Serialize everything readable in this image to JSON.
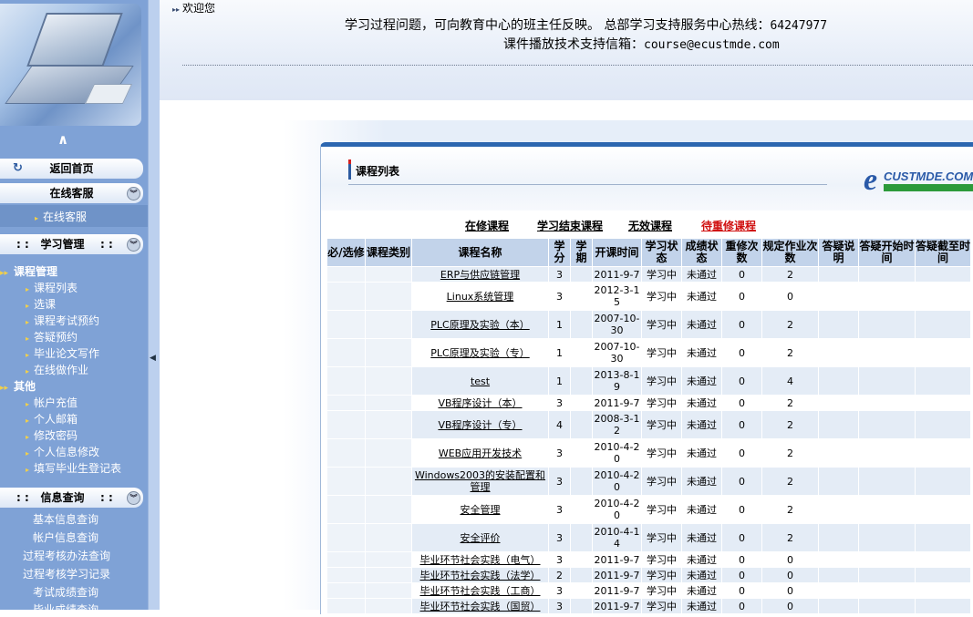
{
  "sidebar": {
    "home_label": "返回首页",
    "online_service": {
      "header": "在线客服",
      "items": [
        "在线客服"
      ]
    },
    "study_mgmt": {
      "header": "学习管理",
      "groups": [
        {
          "label": "课程管理",
          "items": [
            "课程列表",
            "选课",
            "课程考试预约",
            "答疑预约",
            "毕业论文写作",
            "在线做作业"
          ]
        },
        {
          "label": "其他",
          "items": [
            "帐户充值",
            "个人邮箱",
            "修改密码",
            "个人信息修改",
            "填写毕业生登记表"
          ]
        }
      ]
    },
    "info_query": {
      "header": "信息查询",
      "items": [
        "基本信息查询",
        "帐户信息查询",
        "过程考核办法查询",
        "过程考核学习记录",
        "考试成绩查询",
        "毕业成绩查询"
      ]
    }
  },
  "header": {
    "welcome": "欢迎您",
    "notice_line1_text": "学习过程问题，可向教育中心的班主任反映。 总部学习支持服务中心热线：",
    "hotline": "64247977",
    "notice_line2_text": "课件播放技术支持信箱：",
    "email": "course@ecustmde.com"
  },
  "panel": {
    "title": "课程列表",
    "logo_text": "CUSTMDE.COM",
    "logo_letter": "e",
    "tabs": [
      {
        "label": "在修课程",
        "active": false
      },
      {
        "label": "学习结束课程",
        "active": false
      },
      {
        "label": "无效课程",
        "active": false
      },
      {
        "label": "待重修课程",
        "active": true
      }
    ],
    "columns": [
      "必/选修",
      "课程类别",
      "课程名称",
      "学分",
      "学期",
      "开课时间",
      "学习状态",
      "成绩状态",
      "重修次数",
      "规定作业次数",
      "答疑说明",
      "答疑开始时间",
      "答疑截至时间"
    ],
    "rows": [
      {
        "name": "ERP与供应链管理",
        "credit": "3",
        "term": "",
        "start": "2011-9-7",
        "study": "学习中",
        "grade": "未通过",
        "retake": "0",
        "hw": "2"
      },
      {
        "name": "Linux系统管理",
        "credit": "3",
        "term": "",
        "start": "2012-3-15",
        "study": "学习中",
        "grade": "未通过",
        "retake": "0",
        "hw": "0"
      },
      {
        "name": "PLC原理及实验（本）",
        "credit": "1",
        "term": "",
        "start": "2007-10-30",
        "study": "学习中",
        "grade": "未通过",
        "retake": "0",
        "hw": "2"
      },
      {
        "name": "PLC原理及实验（专）",
        "credit": "1",
        "term": "",
        "start": "2007-10-30",
        "study": "学习中",
        "grade": "未通过",
        "retake": "0",
        "hw": "2"
      },
      {
        "name": "test",
        "credit": "1",
        "term": "",
        "start": "2013-8-19",
        "study": "学习中",
        "grade": "未通过",
        "retake": "0",
        "hw": "4"
      },
      {
        "name": "VB程序设计（本）",
        "credit": "3",
        "term": "",
        "start": "2011-9-7",
        "study": "学习中",
        "grade": "未通过",
        "retake": "0",
        "hw": "2"
      },
      {
        "name": "VB程序设计（专）",
        "credit": "4",
        "term": "",
        "start": "2008-3-12",
        "study": "学习中",
        "grade": "未通过",
        "retake": "0",
        "hw": "2"
      },
      {
        "name": "WEB应用开发技术",
        "credit": "3",
        "term": "",
        "start": "2010-4-20",
        "study": "学习中",
        "grade": "未通过",
        "retake": "0",
        "hw": "2"
      },
      {
        "name": "Windows2003的安装配置和管理",
        "credit": "3",
        "term": "",
        "start": "2010-4-20",
        "study": "学习中",
        "grade": "未通过",
        "retake": "0",
        "hw": "2"
      },
      {
        "name": "安全管理",
        "credit": "3",
        "term": "",
        "start": "2010-4-20",
        "study": "学习中",
        "grade": "未通过",
        "retake": "0",
        "hw": "2"
      },
      {
        "name": "安全评价",
        "credit": "3",
        "term": "",
        "start": "2010-4-14",
        "study": "学习中",
        "grade": "未通过",
        "retake": "0",
        "hw": "2"
      },
      {
        "name": "毕业环节社会实践（电气）",
        "credit": "3",
        "term": "",
        "start": "2011-9-7",
        "study": "学习中",
        "grade": "未通过",
        "retake": "0",
        "hw": "0"
      },
      {
        "name": "毕业环节社会实践（法学）",
        "credit": "2",
        "term": "",
        "start": "2011-9-7",
        "study": "学习中",
        "grade": "未通过",
        "retake": "0",
        "hw": "0"
      },
      {
        "name": "毕业环节社会实践（工商）",
        "credit": "3",
        "term": "",
        "start": "2011-9-7",
        "study": "学习中",
        "grade": "未通过",
        "retake": "0",
        "hw": "0"
      },
      {
        "name": "毕业环节社会实践（国贸）",
        "credit": "3",
        "term": "",
        "start": "2011-9-7",
        "study": "学习中",
        "grade": "未通过",
        "retake": "0",
        "hw": "0"
      }
    ]
  },
  "colors": {
    "sidebar_bg": "#7fa2d6",
    "header_th": "#c2d3ea",
    "accent_blue": "#2c66b0",
    "active_tab": "#d01010"
  }
}
